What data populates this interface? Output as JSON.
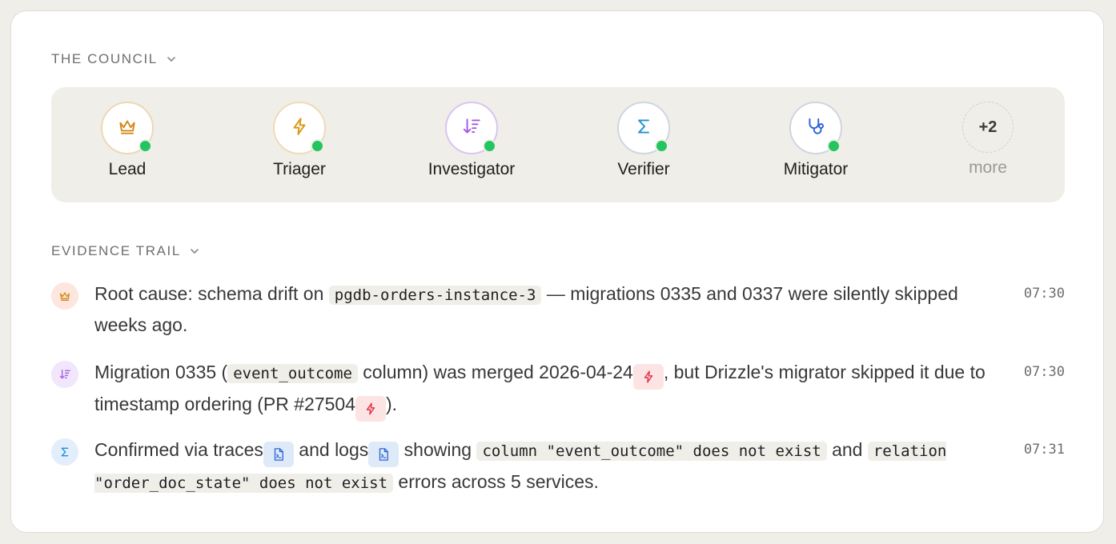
{
  "council": {
    "heading": "THE COUNCIL",
    "members": [
      {
        "name": "Lead",
        "icon": "crown-icon",
        "color": "#d48a1a",
        "ring": "#eed7b6",
        "online": true
      },
      {
        "name": "Triager",
        "icon": "lightning-icon",
        "color": "#d99a18",
        "ring": "#efdbb7",
        "online": true
      },
      {
        "name": "Investigator",
        "icon": "sort-descending-icon",
        "color": "#a25be0",
        "ring": "#dcc3f2",
        "online": true
      },
      {
        "name": "Verifier",
        "icon": "sigma-icon",
        "color": "#1f90d6",
        "ring": "#cfd6e2",
        "online": true
      },
      {
        "name": "Mitigator",
        "icon": "stethoscope-icon",
        "color": "#2c64d8",
        "ring": "#cfd6e2",
        "online": true
      }
    ],
    "more": {
      "count": "+2",
      "label": "more"
    }
  },
  "evidence": {
    "heading": "EVIDENCE TRAIL",
    "items": [
      {
        "icon": "crown-icon",
        "time": "07:30",
        "t1": "Root cause: schema drift on ",
        "code1": "pgdb-orders-instance-3",
        "t2": " — migrations 0335 and 0337 were silently skipped weeks ago."
      },
      {
        "icon": "sort-descending-icon",
        "time": "07:30",
        "t1": "Migration 0335 (",
        "code1": "event_outcome",
        "t2": " column) was merged 2026-04-24",
        "t3": ", but Drizzle's migrator skipped it due to timestamp ordering (PR #27504",
        "t4": ")."
      },
      {
        "icon": "sigma-icon",
        "time": "07:31",
        "t1": "Confirmed via traces",
        "t2": " and logs",
        "t3": " showing ",
        "code1": "column \"event_outcome\" does not exist",
        "t4": " and ",
        "code2": "relation \"order_doc_state\" does not exist",
        "t5": " errors across 5 services."
      }
    ]
  },
  "colors": {
    "online": "#22c55e",
    "chip_red": "#fde4e4",
    "chip_blue": "#dfeaf9",
    "band": "#efeee8"
  }
}
